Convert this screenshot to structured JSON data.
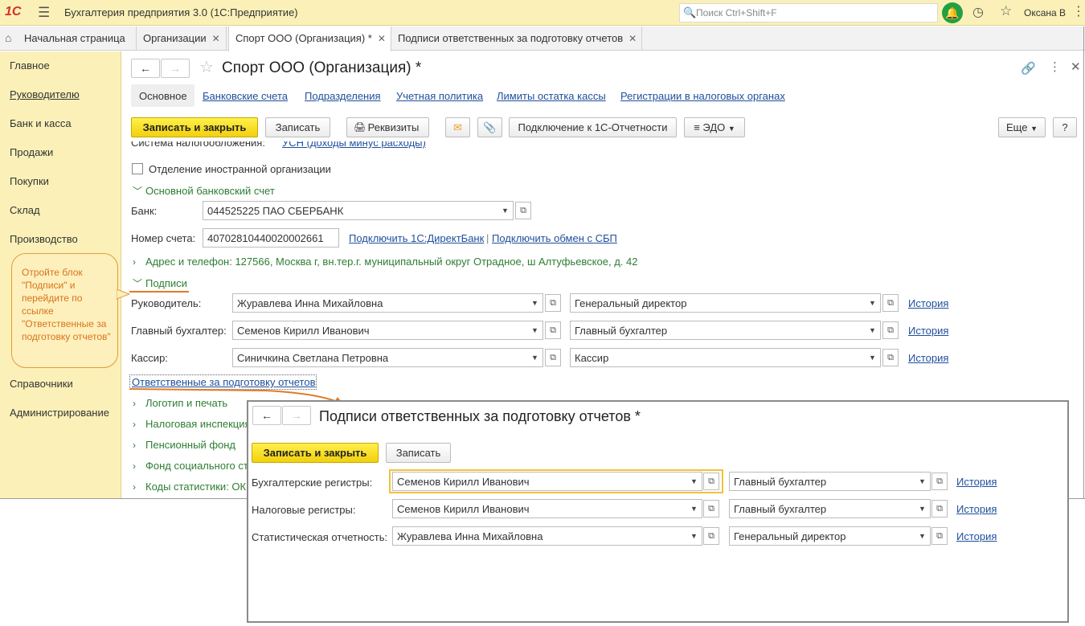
{
  "titlebar": {
    "logo": "1С",
    "title": "Бухгалтерия предприятия 3.0  (1С:Предприятие)",
    "search_placeholder": "Поиск Ctrl+Shift+F",
    "user": "Оксана В"
  },
  "tabs": [
    {
      "label": "Начальная страница"
    },
    {
      "label": "Организации"
    },
    {
      "label": "Спорт ООО (Организация) *"
    },
    {
      "label": "Подписи ответственных за подготовку отчетов"
    }
  ],
  "sidebar": {
    "items": [
      "Главное",
      "Руководителю",
      "Банк и касса",
      "Продажи",
      "Покупки",
      "Склад",
      "Производство",
      "Справочники",
      "Администрирование"
    ]
  },
  "form": {
    "title": "Спорт ООО (Организация) *",
    "subtabs": [
      "Основное",
      "Банковские счета",
      "Подразделения",
      "Учетная политика",
      "Лимиты остатка кассы",
      "Регистрации в налоговых органах"
    ],
    "toolbar": {
      "save_close": "Записать и закрыть",
      "save": "Записать",
      "requisites": "Реквизиты",
      "connect": "Подключение к 1С-Отчетности",
      "edo": "ЭДО",
      "more": "Еще",
      "help": "?"
    },
    "tax_system_label": "Система налогообложения:",
    "tax_system_value": "УСН (доходы минус расходы)",
    "foreign_checkbox": "Отделение иностранной организации",
    "bank_group": "Основной банковский счет",
    "bank_label": "Банк:",
    "bank_value": "044525225 ПАО СБЕРБАНК",
    "account_label": "Номер счета:",
    "account_value": "40702810440020002661",
    "link_directbank": "Подключить 1С:ДиректБанк",
    "link_sbp": "Подключить обмен с СБП",
    "address_group": "Адрес и телефон: 127566, Москва г, вн.тер.г. муниципальный округ Отрадное, ш Алтуфьевское, д. 42",
    "signatures_group": "Подписи",
    "signatures": [
      {
        "label": "Руководитель:",
        "person": "Журавлева Инна Михайловна",
        "position": "Генеральный директор",
        "history": "История"
      },
      {
        "label": "Главный бухгалтер:",
        "person": "Семенов Кирилл Иванович",
        "position": "Главный бухгалтер",
        "history": "История"
      },
      {
        "label": "Кассир:",
        "person": "Синичкина Светлана Петровна",
        "position": "Кассир",
        "history": "История"
      }
    ],
    "responsible_link": "Ответственные за подготовку отчетов",
    "groups_collapsed": [
      "Логотип и печать",
      "Налоговая инспекция",
      "Пенсионный фонд",
      "Фонд социального страхования",
      "Коды статистики: ОКПО"
    ]
  },
  "callout": {
    "text": "Отройте блок \"Подписи\" и перейдите по ссылке \"Ответственные за подготовку отчетов\""
  },
  "popup": {
    "title": "Подписи ответственных за подготовку отчетов *",
    "save_close": "Записать и закрыть",
    "save": "Записать",
    "rows": [
      {
        "label": "Бухгалтерские регистры:",
        "person": "Семенов Кирилл Иванович",
        "position": "Главный бухгалтер",
        "history": "История"
      },
      {
        "label": "Налоговые регистры:",
        "person": "Семенов Кирилл Иванович",
        "position": "Главный бухгалтер",
        "history": "История"
      },
      {
        "label": "Статистическая отчетность:",
        "person": "Журавлева Инна Михайловна",
        "position": "Генеральный директор",
        "history": "История"
      }
    ]
  },
  "colors": {
    "accent_yellow": "#fbf1b8",
    "primary_button": "#f2d00d",
    "link": "#1f4f9c",
    "group_green": "#2e7d32",
    "callout_orange": "#e07b25"
  }
}
